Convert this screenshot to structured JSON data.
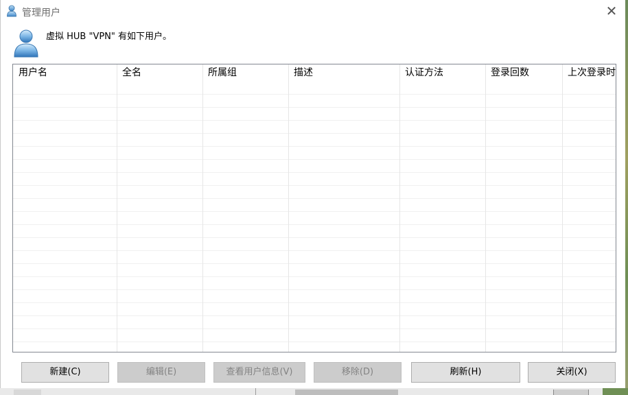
{
  "window": {
    "title": "管理用户",
    "header_message": "虚拟 HUB \"VPN\" 有如下用户。"
  },
  "table": {
    "columns": [
      "用户名",
      "全名",
      "所属组",
      "描述",
      "认证方法",
      "登录回数",
      "上次登录时"
    ],
    "rows": []
  },
  "buttons": {
    "new": {
      "label": "新建(C)",
      "enabled": true
    },
    "edit": {
      "label": "编辑(E)",
      "enabled": false
    },
    "view_info": {
      "label": "查看用户信息(V)",
      "enabled": false
    },
    "remove": {
      "label": "移除(D)",
      "enabled": false
    },
    "refresh": {
      "label": "刷新(H)",
      "enabled": true
    },
    "close": {
      "label": "关闭(X)",
      "enabled": true
    }
  },
  "icons": {
    "title": "user-icon",
    "header": "user-icon",
    "close": "close-icon"
  },
  "colors": {
    "disabled_button_bg": "#cccccc",
    "button_bg": "#e1e1e1",
    "user_icon_blue": "#5b9bd5"
  }
}
